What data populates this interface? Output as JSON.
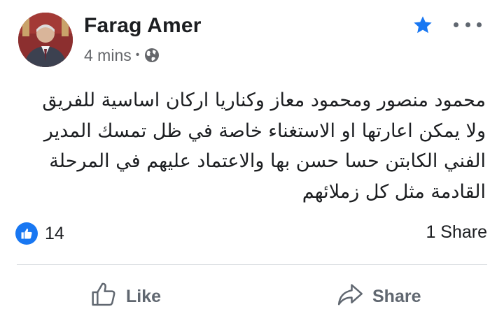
{
  "post": {
    "author": "Farag Amer",
    "time": "4 mins",
    "separator": "•",
    "privacy_icon": "globe-icon",
    "text_lines": [
      "محمود منصور ومحمود معاز وكناريا اركان اساسية للفريق",
      "ولا يمكن اعارتها او الاستغناء  خاصة في ظل تمسك المدير",
      "الفني الكابتن حسا حسن بها  والاعتماد عليهم في المرحلة",
      "القادمة مثل كل زملائهم"
    ]
  },
  "reactions": {
    "icon": "like-reaction-icon",
    "count": "14",
    "shares": "1 Share"
  },
  "actions": {
    "like_label": "Like",
    "share_label": "Share"
  },
  "colors": {
    "accent": "#1877f2",
    "text": "#1c1e21",
    "secondary": "#65676b",
    "divider": "#dadde1"
  }
}
